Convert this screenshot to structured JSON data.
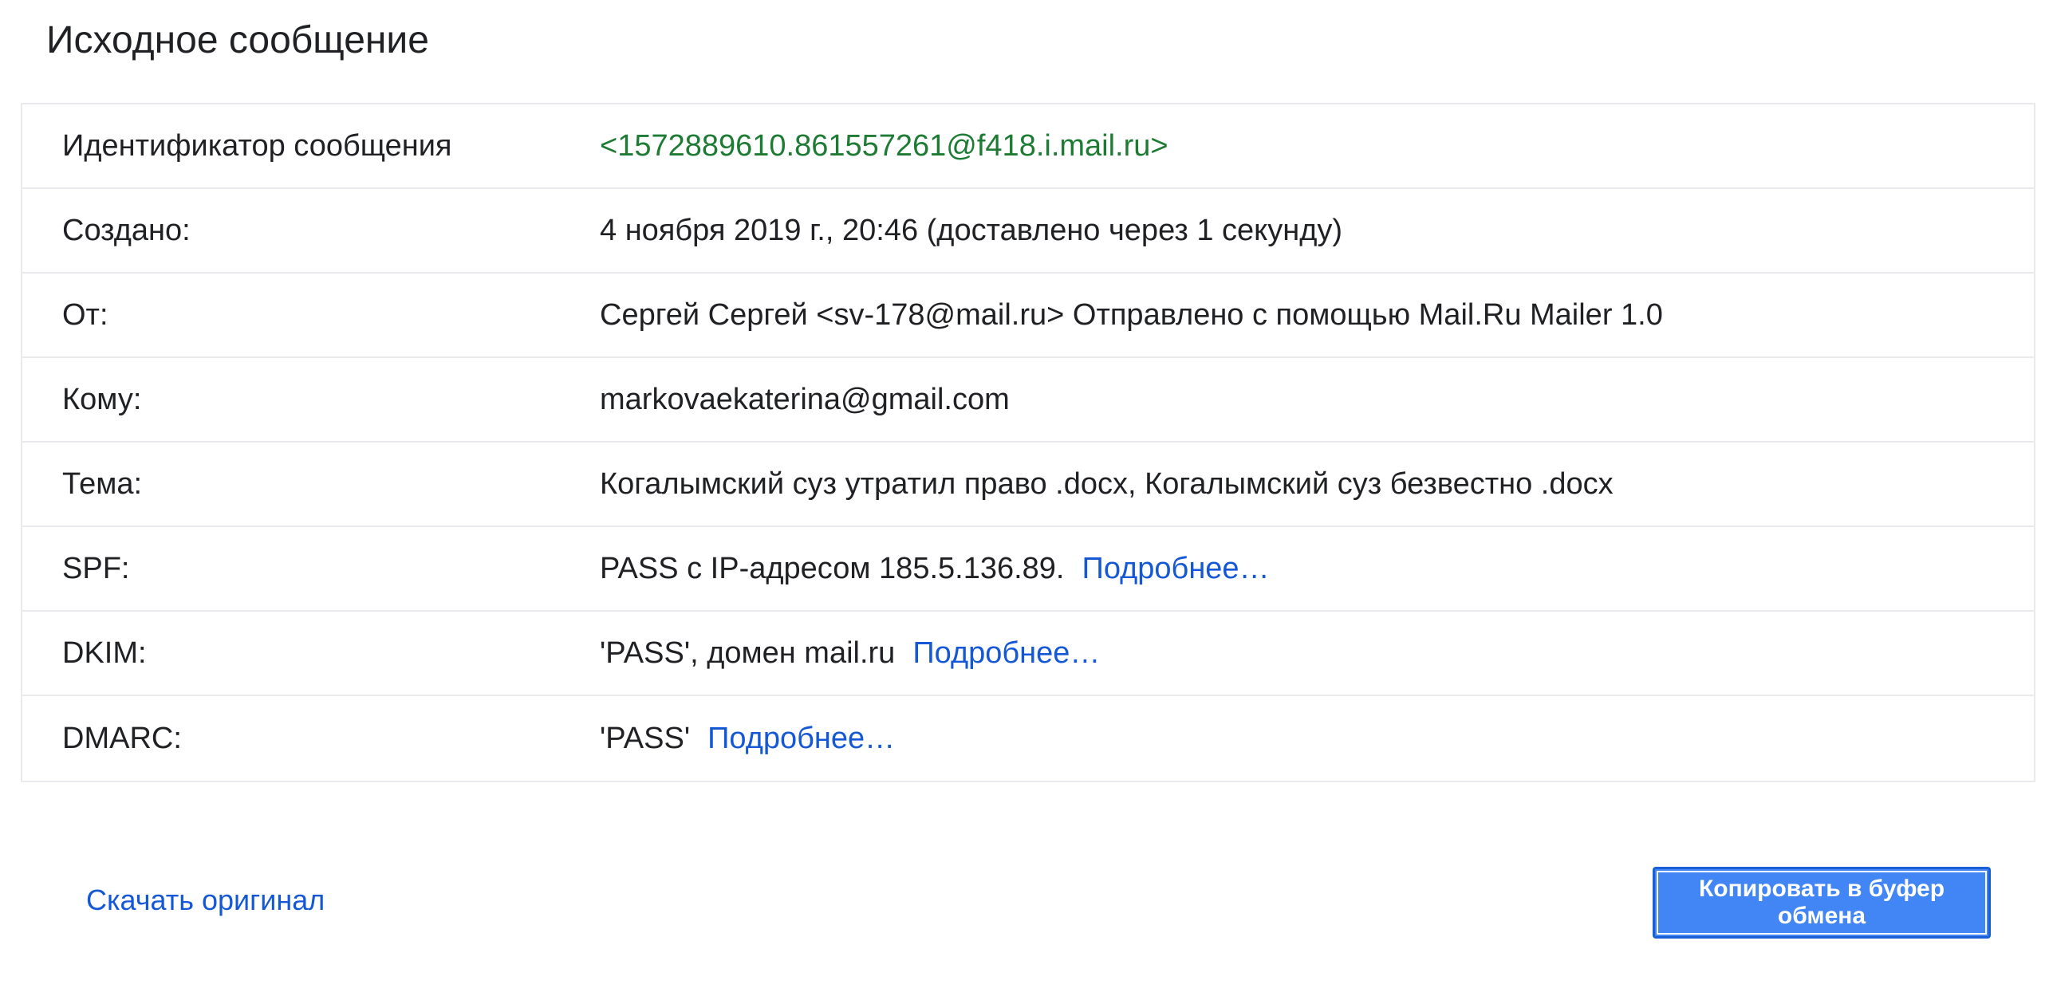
{
  "page": {
    "title": "Исходное сообщение"
  },
  "rows": [
    {
      "label": "Идентификатор сообщения",
      "value": "<1572889610.861557261@f418.i.mail.ru>"
    },
    {
      "label": "Создано:",
      "value": "4 ноября 2019 г., 20:46 (доставлено через 1 секунду)"
    },
    {
      "label": "От:",
      "value": "Сергей Сергей <sv-178@mail.ru> Отправлено с помощью Mail.Ru Mailer 1.0"
    },
    {
      "label": "Кому:",
      "value": "markovaekaterina@gmail.com"
    },
    {
      "label": "Тема:",
      "value": "Когалымский суз утратил право .docx, Когалымский суз безвестно .docx"
    },
    {
      "label": "SPF:",
      "value": "PASS с IP-адресом 185.5.136.89.",
      "link": "Подробнее…"
    },
    {
      "label": "DKIM:",
      "value": "'PASS', домен mail.ru",
      "link": "Подробнее…"
    },
    {
      "label": "DMARC:",
      "value": "'PASS'",
      "link": "Подробнее…"
    }
  ],
  "footer": {
    "download_label": "Скачать оригинал",
    "copy_label": "Копировать в буфер обмена"
  },
  "colors": {
    "message_id": "#1e7b34",
    "link": "#1558d6",
    "button_bg": "#4285f4"
  }
}
